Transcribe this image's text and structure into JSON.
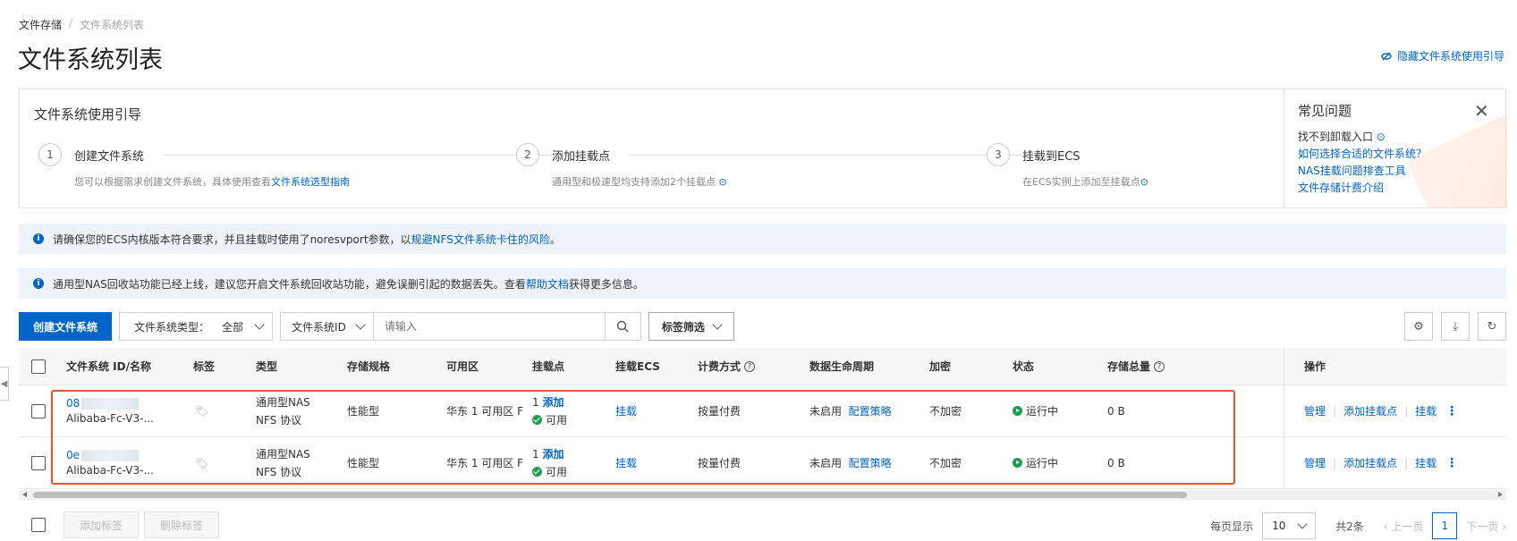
{
  "breadcrumb": {
    "root": "文件存储",
    "current": "文件系统列表"
  },
  "page_title": "文件系统列表",
  "hide_guide_label": "隐藏文件系统使用引导",
  "guide": {
    "title": "文件系统使用引导",
    "steps": [
      {
        "num": "1",
        "title": "创建文件系统",
        "desc": "您可以根据需求创建文件系统，具体使用查看",
        "link": "文件系统选型指南"
      },
      {
        "num": "2",
        "title": "添加挂载点",
        "desc": "通用型和极速型均支持添加2个挂载点"
      },
      {
        "num": "3",
        "title": "挂载到ECS",
        "desc": "在ECS实例上添加至挂载点"
      }
    ],
    "faq": {
      "title": "常见问题",
      "items": [
        "找不到卸载入口",
        "如何选择合适的文件系统？",
        "NAS挂载问题排查工具",
        "文件存储计费介绍"
      ]
    }
  },
  "notices": [
    {
      "pre": "请确保您的ECS内核版本符合要求，并且挂载时使用了noresvport参数，以",
      "link": "规避NFS文件系统卡住的风险",
      "post": "。"
    },
    {
      "pre": "通用型NAS回收站功能已经上线，建议您开启文件系统回收站功能，避免误删引起的数据丢失。查看",
      "link": "帮助文档",
      "post": "获得更多信息。"
    }
  ],
  "toolbar": {
    "create_label": "创建文件系统",
    "type_filter_label": "文件系统类型：",
    "type_filter_value": "全部",
    "search_field": "文件系统ID",
    "search_placeholder": "请输入",
    "tag_filter_label": "标签筛选"
  },
  "table": {
    "headers": {
      "id": "文件系统 ID/名称",
      "tag": "标签",
      "type": "类型",
      "spec": "存储规格",
      "zone": "可用区",
      "mount": "挂载点",
      "mount_ecs": "挂载ECS",
      "billing": "计费方式",
      "lifecycle": "数据生命周期",
      "encrypt": "加密",
      "status": "状态",
      "storage": "存储总量",
      "ops": "操作"
    },
    "rows": [
      {
        "id": "08",
        "name": "Alibaba-Fc-V3-...",
        "type1": "通用型NAS",
        "type2": "NFS 协议",
        "spec": "性能型",
        "zone": "华东 1 可用区 F",
        "mount_count": "1",
        "mount_add": "添加",
        "mount_status": "可用",
        "mount_ecs": "挂载",
        "billing": "按量付费",
        "lifecycle": "未启用",
        "lifecycle_link": "配置策略",
        "encrypt": "不加密",
        "status": "运行中",
        "storage": "0 B",
        "op1": "管理",
        "op2": "添加挂载点",
        "op3": "挂载"
      },
      {
        "id": "0e",
        "name": "Alibaba-Fc-V3-...",
        "type1": "通用型NAS",
        "type2": "NFS 协议",
        "spec": "性能型",
        "zone": "华东 1 可用区 F",
        "mount_count": "1",
        "mount_add": "添加",
        "mount_status": "可用",
        "mount_ecs": "挂载",
        "billing": "按量付费",
        "lifecycle": "未启用",
        "lifecycle_link": "配置策略",
        "encrypt": "不加密",
        "status": "运行中",
        "storage": "0 B",
        "op1": "管理",
        "op2": "添加挂载点",
        "op3": "挂载"
      }
    ]
  },
  "footer": {
    "add_tag": "添加标签",
    "remove_tag": "删除标签",
    "page_size_label": "每页显示",
    "page_size": "10",
    "total": "共2条",
    "prev": "上一页",
    "current_page": "1",
    "next": "下一页"
  }
}
